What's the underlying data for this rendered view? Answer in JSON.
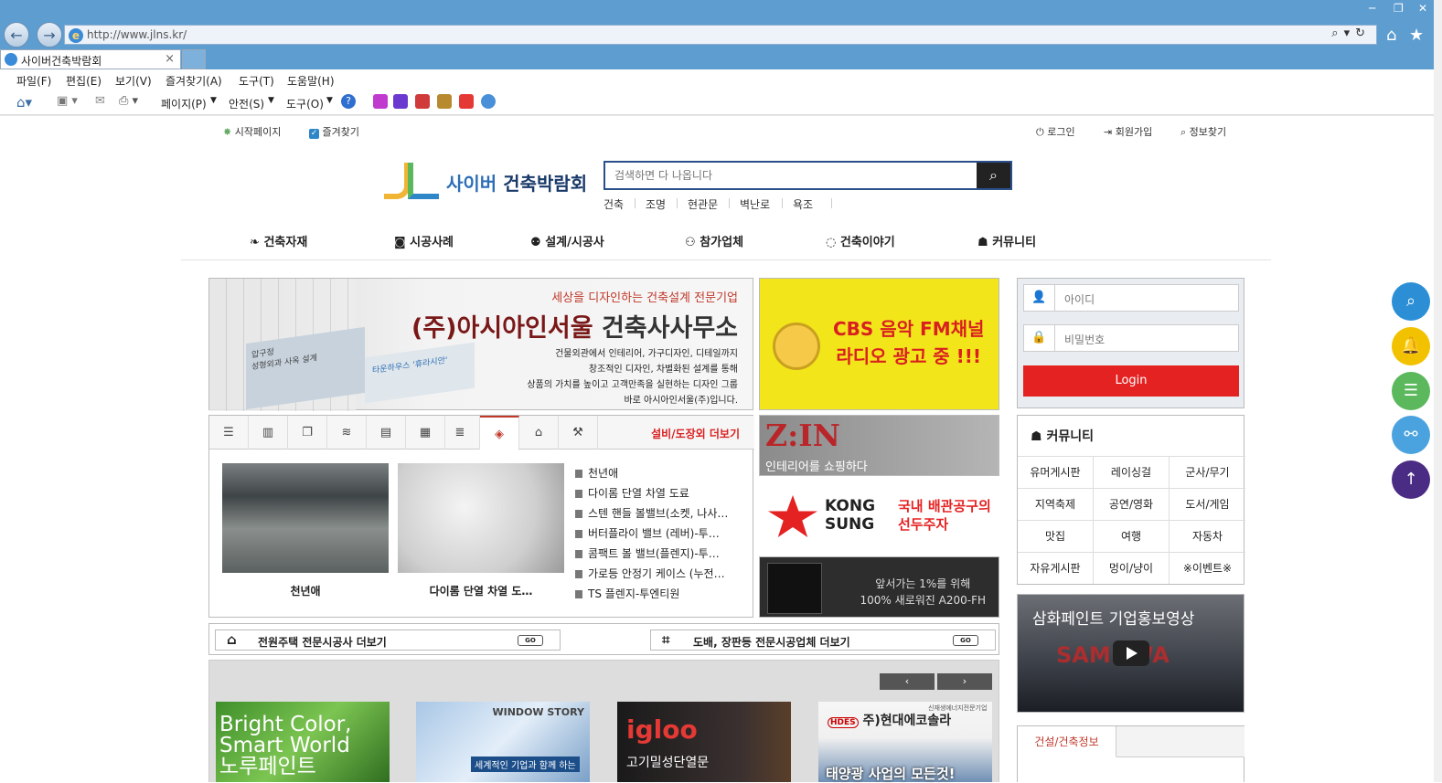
{
  "browser": {
    "url": "http://www.jlns.kr/",
    "tab_title": "사이버건축박람회",
    "menu": [
      "파일(F)",
      "편집(E)",
      "보기(V)",
      "즐겨찾기(A)",
      "도구(T)",
      "도움말(H)"
    ],
    "cmd": {
      "page": "페이지(P)",
      "safety": "안전(S)",
      "tools": "도구(O)"
    }
  },
  "top_links": {
    "start_page": "시작페이지",
    "favorites": "즐겨찾기",
    "login": "로그인",
    "join": "회원가입",
    "find": "정보찾기"
  },
  "logo": {
    "brand": "사이버",
    "name": "건축박람회"
  },
  "search": {
    "placeholder": "검색하면 다 나옵니다"
  },
  "keywords": [
    "건축",
    "조명",
    "현관문",
    "벽난로",
    "욕조"
  ],
  "main_nav": [
    "건축자재",
    "시공사례",
    "설계/시공사",
    "참가업체",
    "건축이야기",
    "커뮤니티"
  ],
  "banner_main": {
    "subtitle": "세상을 디자인하는 건축설계 전문기업",
    "title_brand": "(주)아시아인서울",
    "title_rest": "건축사사무소",
    "desc": [
      "건물외관에서 인테리어, 가구디자인, 디테일까지",
      "창조적인 디자인, 차별화된 설계를 통해",
      "상품의 가치를 높이고 고객만족을 실현하는 디자인 그룹",
      "바로 아시아인서울(주)입니다."
    ],
    "card1": [
      "압구정",
      "성형외과 사옥 설계"
    ],
    "card2": "타운하우스 '휴라시안'"
  },
  "banner_cbs": {
    "line1": "CBS 음악 FM채널",
    "line2": "라디오 광고 중 !!!"
  },
  "login": {
    "id_placeholder": "아이디",
    "pw_placeholder": "비밀번호",
    "button": "Login"
  },
  "tab_panel": {
    "more": "설비/도장외 더보기",
    "tab_icons": [
      "list-icon",
      "building-icon",
      "copy-icon",
      "wifi-icon",
      "archive-icon",
      "grid-icon",
      "table-icon",
      "cube-icon",
      "bank-icon",
      "hammer-icon"
    ],
    "thumbs": [
      {
        "caption": "천년애"
      },
      {
        "caption": "다이롬 단열 차열 도…"
      }
    ],
    "list": [
      "천년애",
      "다이롬 단열 차열 도료",
      "스텐 핸들 볼밸브(소켓, 나사…",
      "버터플라이 밸브 (레버)-투…",
      "콤팩트 볼 밸브(플렌지)-투…",
      "가로등 안정기 케이스 (누전…",
      "TS 플렌지-투엔티원"
    ]
  },
  "ad_zin": {
    "logo": "Z:IN",
    "text": "인테리어를 쇼핑하다"
  },
  "ad_kongsung": {
    "name1": "KONG",
    "name2": "SUNG",
    "desc1": "국내 배관공구의",
    "desc2": "선두주자"
  },
  "ad_lock": {
    "line1": "앞서가는 1%를 위해",
    "line2": "100% 새로워진 A200-FH"
  },
  "community": {
    "title": "커뮤니티",
    "items": [
      "유머게시판",
      "레이싱걸",
      "군사/무기",
      "지역축제",
      "공연/영화",
      "도서/게임",
      "맛집",
      "여행",
      "자동차",
      "자유게시판",
      "멍이/냥이",
      "※이벤트※"
    ]
  },
  "video": {
    "title": "삼화페인트 기업홍보영상",
    "overlay": "SAMHWA"
  },
  "info_tab": {
    "label": "건설/건축정보"
  },
  "link_bar": [
    {
      "label": "전원주택 전문시공사 더보기",
      "go": "GO"
    },
    {
      "label": "도배, 장판등 전문시공업체 더보기",
      "go": "GO"
    }
  ],
  "carousel": {
    "prev": "‹",
    "next": "›"
  },
  "products": {
    "p1": [
      "Bright Color,",
      "Smart World",
      "노루페인트"
    ],
    "p2": {
      "brand": "WINDOW STORY",
      "text": "세계적인 기업과 함께 하는"
    },
    "p3": {
      "brand": "igloo",
      "text": "고기밀성단열문"
    },
    "p4": {
      "brand": "주)현대에코솔라",
      "tag": "HDES",
      "small": "신재생에너지전문기업",
      "text": "태양광 사업의 모든것!"
    }
  },
  "side_buttons": {
    "colors": [
      "#2c8fd6",
      "#f2c100",
      "#5cb85c",
      "#4aa3df",
      "#4b2c84"
    ]
  }
}
